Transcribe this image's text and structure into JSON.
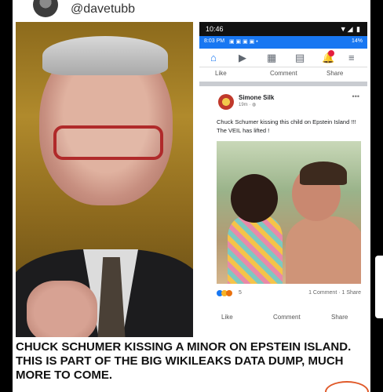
{
  "header": {
    "handle": "@davetubb"
  },
  "phone": {
    "status_time": "10:46",
    "status_icons": "▼◢ ▮",
    "secondary_time": "8:03 PM",
    "secondary_battery": "14%",
    "top_actions": {
      "like": "Like",
      "comment": "Comment",
      "share": "Share"
    },
    "post": {
      "author": "Simone Silk",
      "meta": "19m · ◍",
      "more": "•••",
      "text": "Chuck Schumer kissing this child on Epstein Island !!! The VEIL has lifted !",
      "reaction_count": "5",
      "comments_shares": "1 Comment · 1 Share"
    },
    "bottom_actions": {
      "like": "Like",
      "comment": "Comment",
      "share": "Share"
    }
  },
  "caption": "CHUCK SCHUMER KISSING A MINOR ON EPSTEIN ISLAND. THIS IS PART OF THE BIG WIKILEAKS DATA DUMP, MUCH MORE TO COME.",
  "colors": {
    "fb_blue": "#1877f2",
    "caption_text": "#111111"
  }
}
